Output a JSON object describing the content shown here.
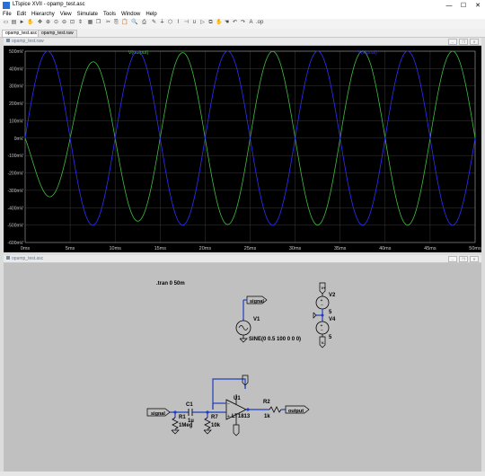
{
  "window": {
    "title": "LTspice XVII - opamp_test.asc",
    "minimize": "—",
    "maximize": "☐",
    "close": "✕"
  },
  "menu": [
    "File",
    "Edit",
    "Hierarchy",
    "View",
    "Simulate",
    "Tools",
    "Window",
    "Help"
  ],
  "tabs": [
    "opamp_test.asc",
    "opamp_test.raw"
  ],
  "plot_window": {
    "title": "opamp_test.raw"
  },
  "schematic_window": {
    "title": "opamp_test.asc"
  },
  "colors": {
    "output_trace": "#3fbf3f",
    "signal_trace": "#2f2fff",
    "wire": "#1f3fbf",
    "plot_bg": "#000000",
    "schematic_bg": "#c0c0c0"
  },
  "chart_data": {
    "type": "line",
    "series": [
      {
        "name": "V(output)",
        "color": "#3fbf3f",
        "amplitude_mV": 500,
        "freq_hz": 100,
        "phase_deg": 180,
        "settle_ms": 5
      },
      {
        "name": "V(signal)",
        "color": "#2f2fff",
        "amplitude_mV": 500,
        "freq_hz": 100,
        "phase_deg": 0
      }
    ],
    "x_unit": "ms",
    "xlim": [
      0,
      50
    ],
    "xticks": [
      "0ms",
      "5ms",
      "10ms",
      "15ms",
      "20ms",
      "25ms",
      "30ms",
      "35ms",
      "40ms",
      "45ms",
      "50ms"
    ],
    "ylim": [
      -600,
      500
    ],
    "yticks": [
      "500mV",
      "400mV",
      "300mV",
      "200mV",
      "100mV",
      "0mV",
      "-100mV",
      "-200mV",
      "-300mV",
      "-400mV",
      "-500mV",
      "-600mV"
    ],
    "grid": true
  },
  "schematic": {
    "directive": ".tran 0 50m",
    "v1_name": "V1",
    "v1_value": "SINE(0 0.5 100 0 0 0)",
    "v2_name": "V2",
    "v2_value": "5",
    "v4_name": "V4",
    "v4_value": "5",
    "net_signal": "signal",
    "net_output": "output",
    "c1_name": "C1",
    "c1_value": "1µ",
    "r1_name": "R1",
    "r1_value": "1Meg",
    "r7_name": "R7",
    "r7_value": "10k",
    "r2_name": "R2",
    "r2_value": "1k",
    "u1_name": "U1",
    "u1_part": "LT1813",
    "vplus": "V+",
    "vminus": "V-"
  }
}
